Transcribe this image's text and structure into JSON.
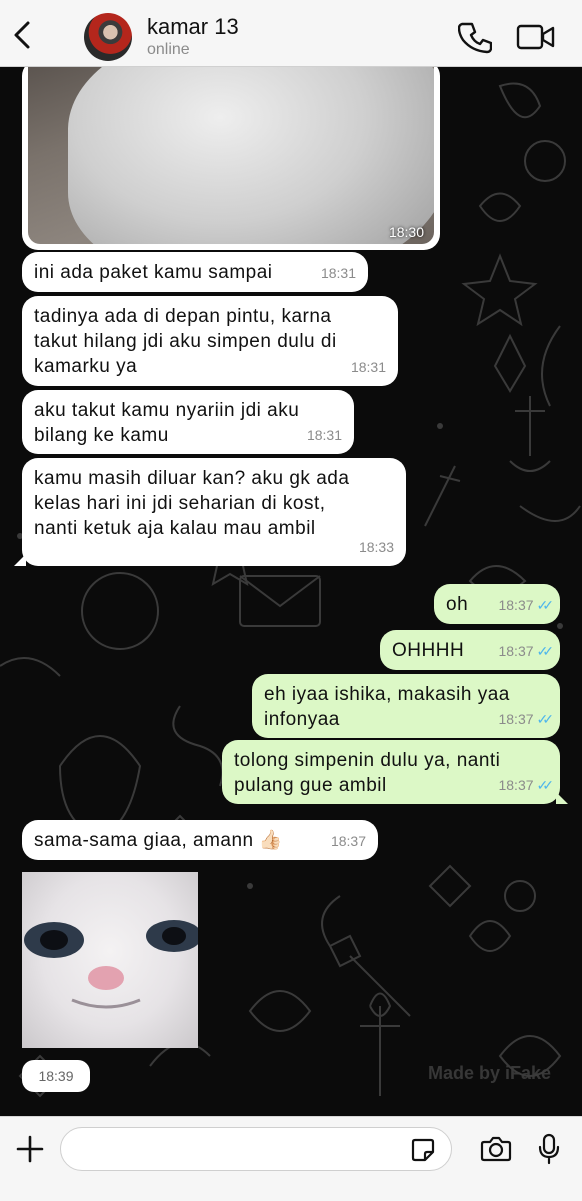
{
  "header": {
    "contact_name": "kamar 13",
    "status": "online"
  },
  "messages": [
    {
      "direction": "in",
      "kind": "image",
      "time": "18:30"
    },
    {
      "direction": "in",
      "text": "ini ada paket kamu sampai",
      "time": "18:31"
    },
    {
      "direction": "in",
      "line1": "tadinya ada di depan pintu, karna",
      "line2": "takut hilang jdi aku simpen dulu di",
      "line3": "kamarku ya",
      "time": "18:31"
    },
    {
      "direction": "in",
      "line1": "aku takut kamu nyariin jdi aku",
      "line2": "bilang ke kamu",
      "time": "18:31"
    },
    {
      "direction": "in",
      "line1": "kamu masih diluar kan? aku gk ada",
      "line2": "kelas hari ini jdi seharian di kost,",
      "line3": "nanti ketuk aja kalau mau ambil",
      "time": "18:33"
    },
    {
      "direction": "out",
      "text": "oh",
      "time": "18:37"
    },
    {
      "direction": "out",
      "text": "OHHHH",
      "time": "18:37"
    },
    {
      "direction": "out",
      "line1": "eh iyaa ishika, makasih yaa",
      "line2": "infonyaa",
      "time": "18:37"
    },
    {
      "direction": "out",
      "line1": "tolong simpenin dulu ya, nanti",
      "line2": "pulang gue ambil",
      "time": "18:37"
    },
    {
      "direction": "in",
      "text": "sama-sama giaa, amann",
      "emoji": "👍🏻",
      "time": "18:37"
    },
    {
      "direction": "in",
      "kind": "sticker",
      "time": "18:39"
    }
  ],
  "read_tick": "✓✓",
  "watermark": "Made by iFake",
  "input": {
    "placeholder": ""
  },
  "colors": {
    "incoming": "#ffffff",
    "outgoing": "#dcf8c6",
    "read_tick": "#4fb6ec",
    "wallpaper": "#0b0b0b"
  }
}
